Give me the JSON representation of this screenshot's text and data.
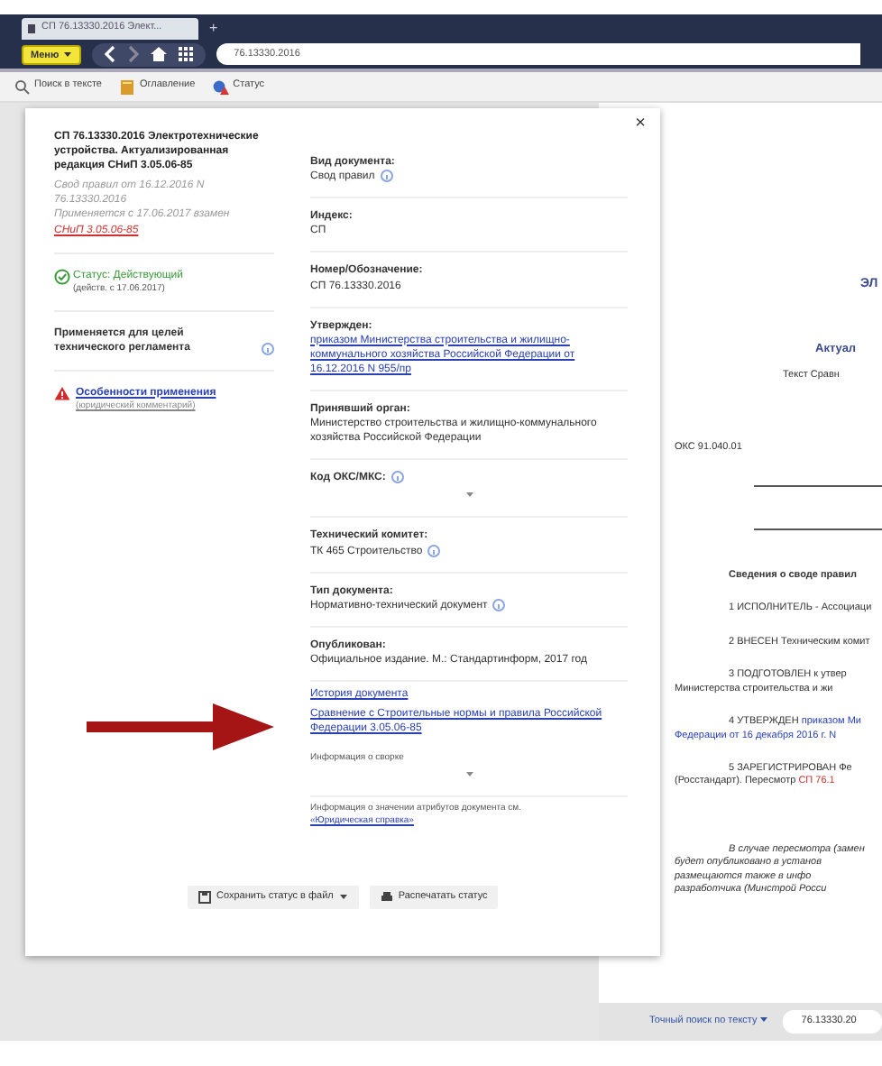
{
  "browser": {
    "tab_title": "СП 76.13330.2016 Элект...",
    "new_tab": "+",
    "menu_button": "Меню",
    "address": "76.13330.2016"
  },
  "toolbar": [
    {
      "label": "Поиск в тексте"
    },
    {
      "label": "Оглавление"
    },
    {
      "label": "Статус"
    }
  ],
  "status_panel": {
    "close": "×",
    "title": "СП 76.13330.2016 Электротехнические устройства. Актуализированная редакция СНиП 3.05.06-85",
    "meta_line": "Свод правил от 16.12.2016 N 76.13330.2016",
    "meta_replaces": "Применяется с 17.06.2017 взамен",
    "meta_replaces_link": "СНиП 3.05.06-85",
    "status": "Статус: Действующий",
    "status_valid": true,
    "status_date": "(действ. с 17.06.2017)",
    "applies_text": "Применяется для целей технического регламента",
    "warning_link": "Особенности применения",
    "warning_sublink": "(юридический комментарий)",
    "fields": [
      {
        "label": "Вид документа:",
        "value": "Свод правил",
        "kind": "text",
        "info": true
      },
      {
        "label": "Индекс:",
        "value": "СП",
        "kind": "text",
        "info": false
      },
      {
        "label": "Номер/Обозначение:",
        "value": "СП 76.13330.2016",
        "kind": "text",
        "info": false
      },
      {
        "label": "Утвержден:",
        "value": "приказом Министерства строительства и жилищно-коммунального хозяйства Российской Федерации от 16.12.2016 N 955/пр",
        "kind": "link",
        "info": false
      },
      {
        "label": "Принявший орган:",
        "value": "Министерство строительства и жилищно-коммунального хозяйства Российской Федерации",
        "kind": "text",
        "info": false
      },
      {
        "label": "Код ОКС/МКС:",
        "kind": "dropdown",
        "info": true
      },
      {
        "label": "Технический комитет:",
        "value": "ТК 465 Строительство",
        "kind": "text",
        "info": true
      },
      {
        "label": "Тип документа:",
        "value": "Нормативно-технический документ",
        "kind": "text",
        "info": true
      },
      {
        "label": "Опубликован:",
        "value": "Официальное издание. М.: Стандартинформ, 2017 год",
        "kind": "text",
        "info": false
      }
    ],
    "links": [
      "История документа",
      "Сравнение с Строительные нормы и правила Российской Федерации 3.05.06-85"
    ],
    "compare_info": "Информация о сворке",
    "footer_text": "Информация о значении атрибутов документа см.",
    "footer_link": "«Юридическая справка»",
    "buttons": [
      {
        "label": "Сохранить статус в файл",
        "caret": true
      },
      {
        "label": "Распечатать статус",
        "caret": false
      }
    ]
  },
  "document": {
    "lines": [
      {
        "kind": "title",
        "parts": [
          {
            "text": "ЭЛ",
            "kind": "plain"
          }
        ]
      },
      {
        "kind": "subtitle",
        "parts": [
          {
            "text": "Актуал",
            "kind": "plain"
          }
        ]
      },
      {
        "kind": "center",
        "parts": [
          {
            "text": "Текст Сравн",
            "kind": "plain"
          }
        ]
      },
      {
        "kind": "code",
        "parts": [
          {
            "text": "ОКС 91.040.01",
            "kind": "plain"
          }
        ]
      },
      {
        "kind": "heading",
        "parts": [
          {
            "text": "Сведения о своде правил",
            "kind": "plain"
          }
        ]
      },
      {
        "kind": "para",
        "parts": [
          {
            "text": "1 ИСПОЛНИТЕЛЬ - Ассоциаци",
            "kind": "plain"
          }
        ]
      },
      {
        "kind": "para",
        "parts": [
          {
            "text": "2 ВНЕСЕН Техническим комит",
            "kind": "plain"
          }
        ]
      },
      {
        "kind": "para",
        "parts": [
          {
            "text": "3 ПОДГОТОВЛЕН к утвер",
            "kind": "plain"
          }
        ]
      },
      {
        "kind": "cont",
        "parts": [
          {
            "text": "Министерства строительства и жи",
            "kind": "plain"
          }
        ]
      },
      {
        "kind": "para",
        "parts": [
          {
            "text": "4 УТВЕРЖДЕН ",
            "kind": "plain"
          },
          {
            "text": "приказом Ми",
            "kind": "link"
          }
        ]
      },
      {
        "kind": "cont",
        "parts": [
          {
            "text": "Федерации от 16 декабря 2016 г. N",
            "kind": "link"
          }
        ]
      },
      {
        "kind": "para",
        "parts": [
          {
            "text": "5 ЗАРЕГИСТРИРОВАН Фе",
            "kind": "plain"
          }
        ]
      },
      {
        "kind": "cont",
        "parts": [
          {
            "text": "(Росстандарт). Пересмотр ",
            "kind": "plain"
          },
          {
            "text": "СП 76.1",
            "kind": "red"
          }
        ]
      },
      {
        "kind": "italic",
        "parts": [
          {
            "text": "В случае пересмотра (замен",
            "kind": "plain"
          }
        ]
      },
      {
        "kind": "italic-cont",
        "parts": [
          {
            "text": "будет опубликовано в установ",
            "kind": "plain"
          }
        ]
      },
      {
        "kind": "italic-cont",
        "parts": [
          {
            "text": "размещаются также в инфо",
            "kind": "plain"
          }
        ]
      },
      {
        "kind": "italic-cont",
        "parts": [
          {
            "text": "разработчика (Минстрой Росси",
            "kind": "plain"
          }
        ]
      }
    ]
  },
  "search_bar": {
    "label": "Точный поиск по тексту",
    "value": "76.13330.20"
  }
}
